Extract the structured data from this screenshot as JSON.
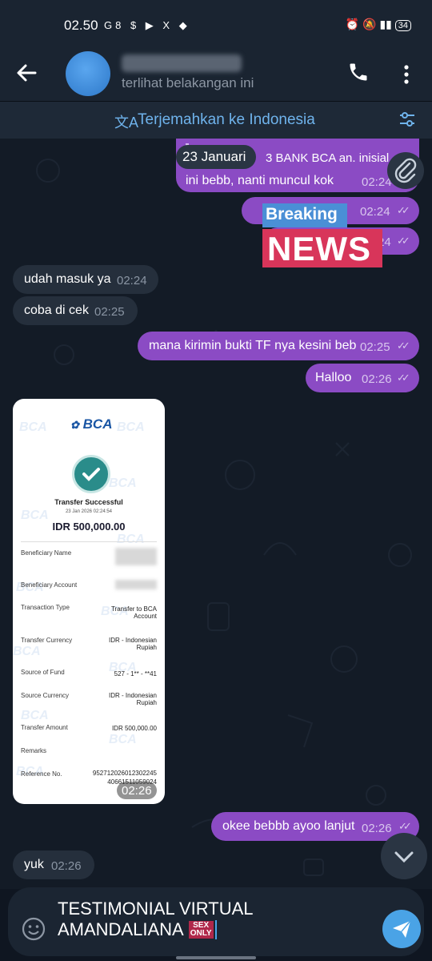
{
  "status_bar": {
    "time": "02.50",
    "left_icons": "G8 $ ▶ X ◆",
    "battery": "34"
  },
  "header": {
    "subtitle": "terlihat belakangan ini"
  },
  "translate_bar": {
    "label": "Terjemahkan ke Indonesia"
  },
  "messages": {
    "date_chip": "23 Januari",
    "m1_line1": "3 BANK BCA an. inisial",
    "m1_line2": "ini bebb, nanti muncul kok",
    "m1_time": "02:24",
    "m2_time": "02:24",
    "m3_time": "24",
    "in1_text": "udah masuk ya",
    "in1_time": "02:24",
    "in2_text": "coba di cek",
    "in2_time": "02:25",
    "out1_text": "mana kirimin bukti TF nya kesini beb",
    "out1_time": "02:25",
    "out2_text": "Halloo",
    "out2_time": "02:26",
    "receipt_time": "02:26",
    "out3_text": "okee bebbb ayoo lanjut",
    "out3_time": "02:26",
    "in3_text": "yuk",
    "in3_time": "02:26"
  },
  "breaking_news": {
    "line1": "Breaking",
    "line2": "NEWS"
  },
  "receipt": {
    "brand": "BCA",
    "status": "Transfer Successful",
    "datetime": "23 Jan 2026 02:24:54",
    "amount": "IDR 500,000.00",
    "rows": {
      "beneficiary_name": "Beneficiary Name",
      "beneficiary_account": "Beneficiary Account",
      "transaction_type": "Transaction Type",
      "transaction_type_value": "Transfer to BCA Account",
      "transfer_currency": "Transfer Currency",
      "transfer_currency_value": "IDR - Indonesian Rupiah",
      "source_of_fund": "Source of Fund",
      "source_of_fund_value": "527 - 1** - **41",
      "source_currency": "Source Currency",
      "source_currency_value": "IDR - Indonesian Rupiah",
      "transfer_amount": "Transfer Amount",
      "transfer_amount_value": "IDR 500,000.00",
      "remarks": "Remarks",
      "reference_no": "Reference No.",
      "reference_no_value": "95271202601230224540661511059024"
    }
  },
  "input": {
    "line1": "TESTIMONIAL VIRTUAL",
    "line2": "AMANDALIANA",
    "badge_top": "SEX",
    "badge_bottom": "ONLY"
  },
  "colors": {
    "outgoing": "#8b4bc4",
    "incoming": "#252f3c",
    "accent": "#4aa3e6"
  },
  "icons": [
    "back-arrow-icon",
    "phone-icon",
    "more-vert-icon",
    "translate-icon",
    "filter-icon",
    "paperclip-icon",
    "double-check-icon",
    "checkmark-icon",
    "chevron-down-icon",
    "emoji-icon",
    "send-icon"
  ]
}
